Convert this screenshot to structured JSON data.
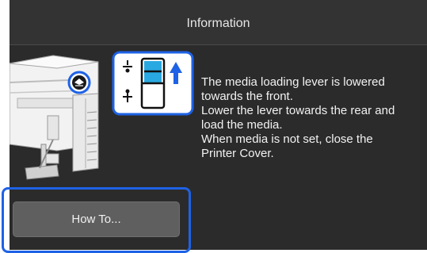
{
  "header": {
    "title": "Information"
  },
  "message": {
    "lines": [
      "The media loading lever is lowered",
      "towards the front.",
      "Lower the lever towards the rear and",
      "load the media.",
      "When media is not set, close the",
      "Printer Cover."
    ]
  },
  "actions": {
    "how_to_label": "How To..."
  },
  "colors": {
    "screen_background": "#2b2b2b",
    "header_background": "#333333",
    "highlight_border": "#1e62e6",
    "lever_fill": "#29a9e1",
    "arrow": "#1e62e6",
    "button_background": "#5f5f5f"
  },
  "icons": {
    "printer_illustration": "printer-with-lever-illustration",
    "lever_indicator": "lever-up-indicator-icon",
    "up_arrow": "up-arrow-icon",
    "paper_loading": "paper-loading-icon"
  }
}
